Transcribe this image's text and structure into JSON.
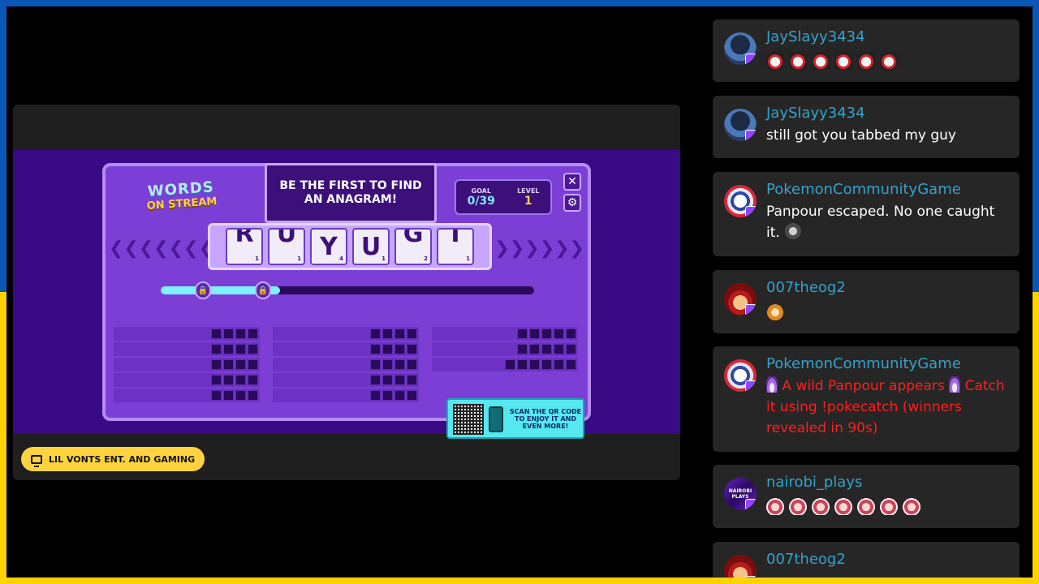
{
  "game": {
    "logo_top": "WORDS",
    "logo_bottom": "ON STREAM",
    "prompt": "BE THE FIRST TO FIND AN ANAGRAM!",
    "goal_label": "GOAL",
    "goal_value": "0/39",
    "level_label": "LEVEL",
    "level_value": "1",
    "close_glyph": "✕",
    "settings_glyph": "⚙",
    "rail_left": "❮❮❮❮❮❮❮",
    "rail_right": "❯❯❯❯❯❯❯",
    "lock_glyph": "🔒",
    "tiles": [
      {
        "letter": "R",
        "points": "1",
        "rolling": true
      },
      {
        "letter": "U",
        "points": "1",
        "rolling": true
      },
      {
        "letter": "Y",
        "points": "4",
        "rolling": false
      },
      {
        "letter": "U",
        "points": "1",
        "rolling": false
      },
      {
        "letter": "G",
        "points": "2",
        "rolling": true
      },
      {
        "letter": "I",
        "points": "1",
        "rolling": true
      }
    ],
    "progress_fraction": 0.32,
    "qr_text": "SCAN THE QR CODE TO ENJOY IT AND EVEN MORE!",
    "icons": {
      "qr": "qr-code-icon",
      "phone": "phone-icon",
      "close": "close-icon",
      "settings": "gear-icon",
      "lock": "lock-icon"
    }
  },
  "channel": {
    "name": "LIL VONTS ENT. AND GAMING",
    "icon": "tv-icon",
    "color": "#ffd33f"
  },
  "chat": {
    "username_color": "#35a2c9",
    "alert_color": "#ff1f1f",
    "messages": [
      {
        "user": "JaySlayy3434",
        "text": "",
        "emotes": 6,
        "emote_kind": "cat-emote-icon"
      },
      {
        "user": "JaySlayy3434",
        "text": "still got you tabbed my guy"
      },
      {
        "user": "PokemonCommunityGame",
        "text": "Panpour escaped. No one caught it."
      },
      {
        "user": "007theog2",
        "text": "",
        "emotes": 1,
        "emote_kind": "dog-emote-icon"
      },
      {
        "user": "PokemonCommunityGame",
        "text": "A wild Panpour appears",
        "text2": "Catch it using !pokecatch (winners revealed in 90s)"
      },
      {
        "user": "nairobi_plays",
        "avatar_text": "NAIROBI PLAYS",
        "text": "",
        "emotes": 7,
        "emote_kind": "girl-emote-icon"
      },
      {
        "user": "007theog2",
        "text": ""
      }
    ]
  }
}
